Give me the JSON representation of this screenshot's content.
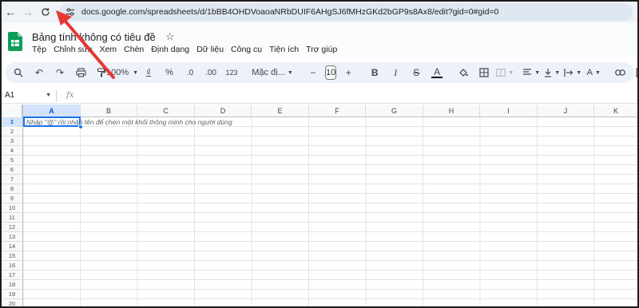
{
  "browser": {
    "back_icon": "arrow-left-icon",
    "forward_icon": "arrow-right-icon",
    "reload_icon": "reload-icon",
    "url": "docs.google.com/spreadsheets/d/1bBB4OHDVoaoaNRbDUIF6AHgSJ6fMHzGKd2bGP9s8Ax8/edit?gid=0#gid=0"
  },
  "doc": {
    "title": "Bảng tính không có tiêu đề"
  },
  "menu": [
    "Tệp",
    "Chỉnh sửa",
    "Xem",
    "Chèn",
    "Định dạng",
    "Dữ liệu",
    "Công cụ",
    "Tiện ích",
    "Trợ giúp"
  ],
  "toolbar": {
    "zoom": "100%",
    "currency": "₫",
    "percent": "%",
    "dec_decrease": ".0",
    "dec_increase": ".00",
    "number_format": "123",
    "font": "Mặc đị...",
    "font_size": "10",
    "bold": "B",
    "text_color": "A"
  },
  "formula_bar": {
    "cell_ref": "A1",
    "fx_label": "fx"
  },
  "grid": {
    "columns": [
      "A",
      "B",
      "C",
      "D",
      "E",
      "F",
      "G",
      "H",
      "I",
      "J",
      "K"
    ],
    "rows": [
      "1",
      "2",
      "3",
      "4",
      "5",
      "6",
      "7",
      "8",
      "9",
      "10",
      "11",
      "12",
      "13",
      "14",
      "15",
      "16",
      "17",
      "18",
      "19",
      "20"
    ],
    "selected_cell": "A1",
    "hint": "Nhập \"@\" rồi nhập tên để chèn một khối thông minh cho người dùng"
  },
  "colors": {
    "accent": "#1a73e8",
    "sheets_green": "#0f9d58",
    "annotation_red": "#e53935"
  }
}
